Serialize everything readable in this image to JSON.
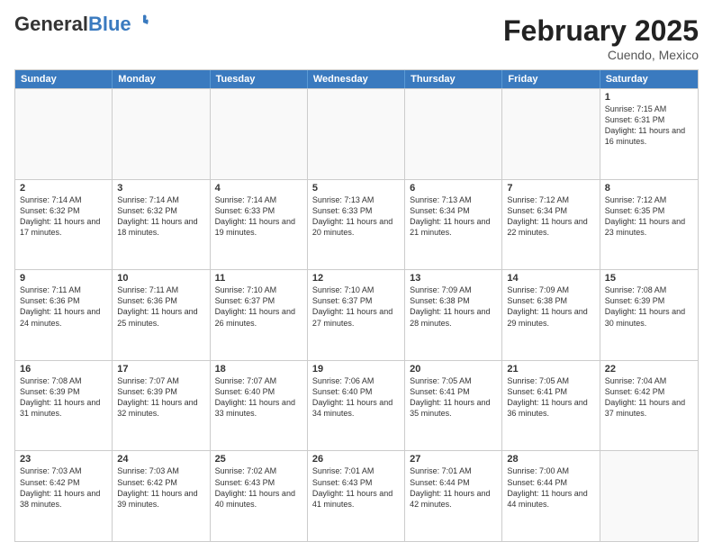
{
  "header": {
    "logo_general": "General",
    "logo_blue": "Blue",
    "month_year": "February 2025",
    "location": "Cuendo, Mexico"
  },
  "calendar": {
    "days_of_week": [
      "Sunday",
      "Monday",
      "Tuesday",
      "Wednesday",
      "Thursday",
      "Friday",
      "Saturday"
    ],
    "weeks": [
      [
        {
          "day": "",
          "empty": true
        },
        {
          "day": "",
          "empty": true
        },
        {
          "day": "",
          "empty": true
        },
        {
          "day": "",
          "empty": true
        },
        {
          "day": "",
          "empty": true
        },
        {
          "day": "",
          "empty": true
        },
        {
          "day": "1",
          "empty": false,
          "text": "Sunrise: 7:15 AM\nSunset: 6:31 PM\nDaylight: 11 hours and 16 minutes."
        }
      ],
      [
        {
          "day": "2",
          "empty": false,
          "text": "Sunrise: 7:14 AM\nSunset: 6:32 PM\nDaylight: 11 hours and 17 minutes."
        },
        {
          "day": "3",
          "empty": false,
          "text": "Sunrise: 7:14 AM\nSunset: 6:32 PM\nDaylight: 11 hours and 18 minutes."
        },
        {
          "day": "4",
          "empty": false,
          "text": "Sunrise: 7:14 AM\nSunset: 6:33 PM\nDaylight: 11 hours and 19 minutes."
        },
        {
          "day": "5",
          "empty": false,
          "text": "Sunrise: 7:13 AM\nSunset: 6:33 PM\nDaylight: 11 hours and 20 minutes."
        },
        {
          "day": "6",
          "empty": false,
          "text": "Sunrise: 7:13 AM\nSunset: 6:34 PM\nDaylight: 11 hours and 21 minutes."
        },
        {
          "day": "7",
          "empty": false,
          "text": "Sunrise: 7:12 AM\nSunset: 6:34 PM\nDaylight: 11 hours and 22 minutes."
        },
        {
          "day": "8",
          "empty": false,
          "text": "Sunrise: 7:12 AM\nSunset: 6:35 PM\nDaylight: 11 hours and 23 minutes."
        }
      ],
      [
        {
          "day": "9",
          "empty": false,
          "text": "Sunrise: 7:11 AM\nSunset: 6:36 PM\nDaylight: 11 hours and 24 minutes."
        },
        {
          "day": "10",
          "empty": false,
          "text": "Sunrise: 7:11 AM\nSunset: 6:36 PM\nDaylight: 11 hours and 25 minutes."
        },
        {
          "day": "11",
          "empty": false,
          "text": "Sunrise: 7:10 AM\nSunset: 6:37 PM\nDaylight: 11 hours and 26 minutes."
        },
        {
          "day": "12",
          "empty": false,
          "text": "Sunrise: 7:10 AM\nSunset: 6:37 PM\nDaylight: 11 hours and 27 minutes."
        },
        {
          "day": "13",
          "empty": false,
          "text": "Sunrise: 7:09 AM\nSunset: 6:38 PM\nDaylight: 11 hours and 28 minutes."
        },
        {
          "day": "14",
          "empty": false,
          "text": "Sunrise: 7:09 AM\nSunset: 6:38 PM\nDaylight: 11 hours and 29 minutes."
        },
        {
          "day": "15",
          "empty": false,
          "text": "Sunrise: 7:08 AM\nSunset: 6:39 PM\nDaylight: 11 hours and 30 minutes."
        }
      ],
      [
        {
          "day": "16",
          "empty": false,
          "text": "Sunrise: 7:08 AM\nSunset: 6:39 PM\nDaylight: 11 hours and 31 minutes."
        },
        {
          "day": "17",
          "empty": false,
          "text": "Sunrise: 7:07 AM\nSunset: 6:39 PM\nDaylight: 11 hours and 32 minutes."
        },
        {
          "day": "18",
          "empty": false,
          "text": "Sunrise: 7:07 AM\nSunset: 6:40 PM\nDaylight: 11 hours and 33 minutes."
        },
        {
          "day": "19",
          "empty": false,
          "text": "Sunrise: 7:06 AM\nSunset: 6:40 PM\nDaylight: 11 hours and 34 minutes."
        },
        {
          "day": "20",
          "empty": false,
          "text": "Sunrise: 7:05 AM\nSunset: 6:41 PM\nDaylight: 11 hours and 35 minutes."
        },
        {
          "day": "21",
          "empty": false,
          "text": "Sunrise: 7:05 AM\nSunset: 6:41 PM\nDaylight: 11 hours and 36 minutes."
        },
        {
          "day": "22",
          "empty": false,
          "text": "Sunrise: 7:04 AM\nSunset: 6:42 PM\nDaylight: 11 hours and 37 minutes."
        }
      ],
      [
        {
          "day": "23",
          "empty": false,
          "text": "Sunrise: 7:03 AM\nSunset: 6:42 PM\nDaylight: 11 hours and 38 minutes."
        },
        {
          "day": "24",
          "empty": false,
          "text": "Sunrise: 7:03 AM\nSunset: 6:42 PM\nDaylight: 11 hours and 39 minutes."
        },
        {
          "day": "25",
          "empty": false,
          "text": "Sunrise: 7:02 AM\nSunset: 6:43 PM\nDaylight: 11 hours and 40 minutes."
        },
        {
          "day": "26",
          "empty": false,
          "text": "Sunrise: 7:01 AM\nSunset: 6:43 PM\nDaylight: 11 hours and 41 minutes."
        },
        {
          "day": "27",
          "empty": false,
          "text": "Sunrise: 7:01 AM\nSunset: 6:44 PM\nDaylight: 11 hours and 42 minutes."
        },
        {
          "day": "28",
          "empty": false,
          "text": "Sunrise: 7:00 AM\nSunset: 6:44 PM\nDaylight: 11 hours and 44 minutes."
        },
        {
          "day": "",
          "empty": true
        }
      ]
    ]
  }
}
